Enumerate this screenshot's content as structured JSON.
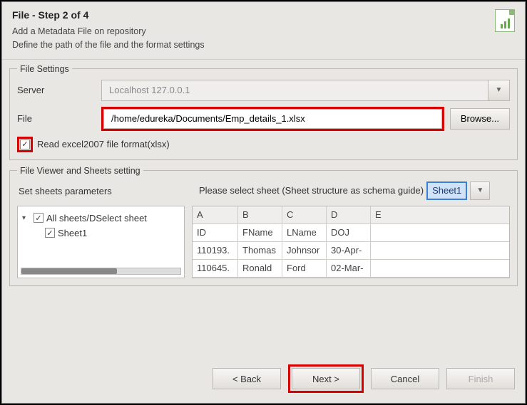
{
  "header": {
    "title": "File - Step 2 of 4",
    "subtitle1": "Add a Metadata File on repository",
    "subtitle2": "Define the path of the file and the format settings"
  },
  "fileSettings": {
    "legend": "File Settings",
    "serverLabel": "Server",
    "serverValue": "Localhost 127.0.0.1",
    "fileLabel": "File",
    "filePath": "/home/edureka/Documents/Emp_details_1.xlsx",
    "browse": "Browse...",
    "checkboxLabel": "Read excel2007 file format(xlsx)"
  },
  "viewer": {
    "legend": "File Viewer and Sheets setting",
    "paramsLabel": "Set sheets parameters",
    "selectSheetLabel": "Please select sheet (Sheet structure as schema guide)",
    "selectedSheet": "Sheet1",
    "tree": {
      "root": "All sheets/DSelect sheet",
      "child": "Sheet1"
    },
    "grid": {
      "columns": [
        "A",
        "B",
        "C",
        "D",
        "E"
      ],
      "rows": [
        [
          "ID",
          "FName",
          "LName",
          "DOJ",
          ""
        ],
        [
          "110193.",
          "Thomas",
          "Johnsor",
          "30-Apr-",
          ""
        ],
        [
          "110645.",
          "Ronald",
          "Ford",
          "02-Mar-",
          ""
        ]
      ]
    }
  },
  "buttons": {
    "back": "< Back",
    "next": "Next >",
    "cancel": "Cancel",
    "finish": "Finish"
  }
}
